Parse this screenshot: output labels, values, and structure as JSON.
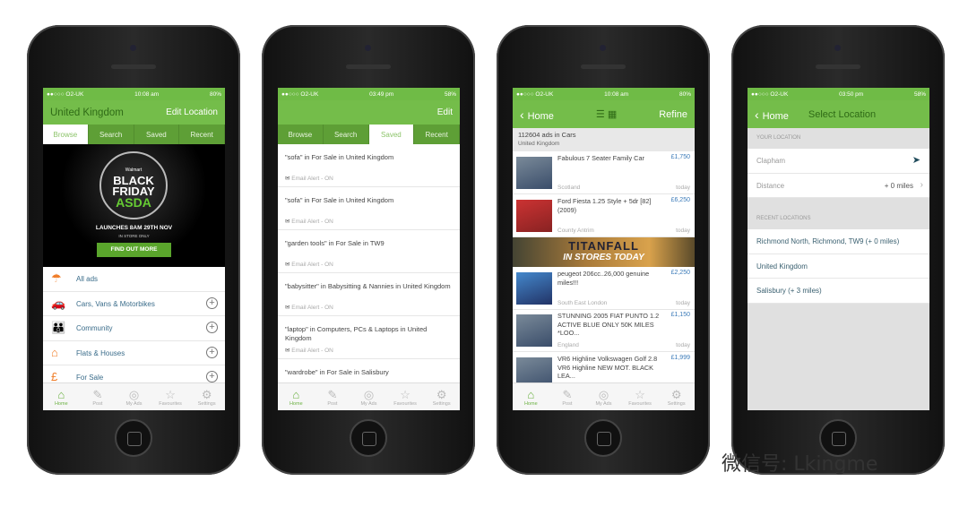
{
  "phones": [
    {
      "status": {
        "carrier": "●●○○○ O2-UK",
        "time": "10:08 am",
        "battery": "80%"
      },
      "header": {
        "title": "United Kingdom",
        "right": "Edit Location"
      },
      "tabs": [
        "Browse",
        "Search",
        "Saved",
        "Recent"
      ],
      "active_tab": 0,
      "banner": {
        "brand": "Walmart",
        "line1": "BLACK",
        "line2": "FRIDAY",
        "from": "FROM",
        "store": "ASDA",
        "launch": "LAUNCHES 8AM 29TH NOV",
        "note": "IN STORE ONLY",
        "cta": "FIND OUT MORE"
      },
      "categories": [
        {
          "label": "All ads",
          "icon": "all-ads-icon",
          "glyph": "☂",
          "expand": false
        },
        {
          "label": "Cars, Vans & Motorbikes",
          "icon": "car-icon",
          "glyph": "🚗",
          "expand": true
        },
        {
          "label": "Community",
          "icon": "community-icon",
          "glyph": "👪",
          "expand": true
        },
        {
          "label": "Flats & Houses",
          "icon": "house-icon",
          "glyph": "⌂",
          "expand": true
        },
        {
          "label": "For Sale",
          "icon": "for-sale-icon",
          "glyph": "£",
          "expand": true
        }
      ]
    },
    {
      "status": {
        "carrier": "●●○○○ O2-UK",
        "time": "03:49 pm",
        "battery": "58%"
      },
      "header": {
        "title": "",
        "right": "Edit"
      },
      "tabs": [
        "Browse",
        "Search",
        "Saved",
        "Recent"
      ],
      "active_tab": 2,
      "saved": [
        {
          "title": "\"sofa\" in For Sale in United Kingdom",
          "alert": "Email Alert - ON"
        },
        {
          "title": "\"sofa\" in For Sale in United Kingdom",
          "alert": "Email Alert - ON"
        },
        {
          "title": "\"garden tools\" in For Sale in TW9",
          "alert": "Email Alert - ON"
        },
        {
          "title": "\"babysitter\" in Babysitting & Nannies in United Kingdom",
          "alert": "Email Alert - ON"
        },
        {
          "title": "\"laptop\" in Computers, PCs & Laptops in United Kingdom",
          "alert": "Email Alert - ON"
        },
        {
          "title": "\"wardrobe\" in For Sale in Salisbury",
          "alert": ""
        }
      ]
    },
    {
      "status": {
        "carrier": "●●○○○ O2-UK",
        "time": "10:08 am",
        "battery": "80%"
      },
      "header": {
        "back": "Home",
        "right": "Refine"
      },
      "info": {
        "count": "112604 ads in Cars",
        "location": "United Kingdom"
      },
      "ads": [
        {
          "title": "Fabulous 7 Seater Family Car",
          "price": "£1,750",
          "location": "Scotland",
          "date": "today"
        },
        {
          "title": "Ford Fiesta 1.25 Style + 5dr [82] (2009)",
          "price": "£6,250",
          "location": "County Antrim",
          "date": "today"
        },
        {
          "title": "peugeot 206cc..26,000 genuine miles!!!",
          "price": "£2,250",
          "location": "South East London",
          "date": "today"
        },
        {
          "title": "STUNNING 2005 FIAT PUNTO 1.2 ACTIVE BLUE ONLY 50K MILES *LOO...",
          "price": "£1,150",
          "location": "England",
          "date": "today"
        },
        {
          "title": "VR6 Highline Volkswagen Golf 2.8 VR6 Highline NEW MOT. BLACK LEA...",
          "price": "£1,999",
          "location": "",
          "date": ""
        }
      ],
      "ad_banner": {
        "line1": "TITANFALL",
        "line2": "IN STORES TODAY"
      }
    },
    {
      "status": {
        "carrier": "●●○○○ O2-UK",
        "time": "03:50 pm",
        "battery": "58%"
      },
      "header": {
        "back": "Home",
        "title": "Select Location"
      },
      "your_location": {
        "heading": "YOUR LOCATION",
        "place": "Clapham",
        "distance_label": "Distance",
        "distance_value": "+ 0 miles"
      },
      "recent": {
        "heading": "RECENT LOCATIONS",
        "items": [
          "Richmond North, Richmond, TW9 (+ 0 miles)",
          "United Kingdom",
          "Salisbury (+ 3 miles)"
        ]
      }
    }
  ],
  "tabbar": [
    {
      "label": "Home",
      "icon": "home-icon",
      "glyph": "⌂"
    },
    {
      "label": "Post",
      "icon": "pin-icon",
      "glyph": "✎"
    },
    {
      "label": "My Ads",
      "icon": "my-ads-icon",
      "glyph": "◎"
    },
    {
      "label": "Favourites",
      "icon": "star-icon",
      "glyph": "☆"
    },
    {
      "label": "Settings",
      "icon": "gear-icon",
      "glyph": "⚙"
    }
  ],
  "watermark": "微信号: Lkingme",
  "colors": {
    "green": "#74bd4a",
    "dark_green": "#5e9f36",
    "price_blue": "#3a7ab8"
  }
}
